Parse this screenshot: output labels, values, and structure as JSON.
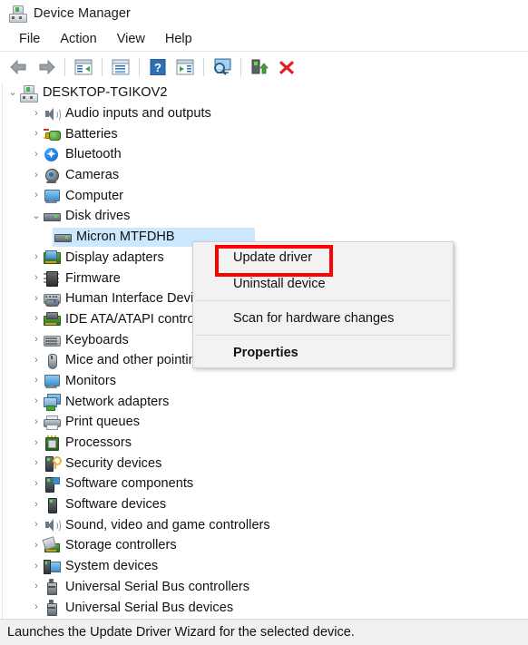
{
  "window": {
    "title": "Device Manager",
    "icon": "device-manager-icon"
  },
  "menubar": {
    "items": [
      {
        "label": "File"
      },
      {
        "label": "Action"
      },
      {
        "label": "View"
      },
      {
        "label": "Help"
      }
    ]
  },
  "toolbar": {
    "buttons": [
      {
        "name": "back-button",
        "icon": "back-arrow-icon"
      },
      {
        "name": "forward-button",
        "icon": "forward-arrow-icon"
      },
      {
        "name": "separator-1",
        "icon": "separator"
      },
      {
        "name": "show-hide-console-tree-button",
        "icon": "console-tree-icon"
      },
      {
        "name": "separator-2",
        "icon": "separator"
      },
      {
        "name": "properties-button",
        "icon": "properties-window-icon"
      },
      {
        "name": "separator-3",
        "icon": "separator"
      },
      {
        "name": "help-button",
        "icon": "question-mark-icon"
      },
      {
        "name": "update-driver-button",
        "icon": "update-driver-icon"
      },
      {
        "name": "separator-4",
        "icon": "separator"
      },
      {
        "name": "scan-hardware-changes-button",
        "icon": "scan-monitor-icon"
      },
      {
        "name": "separator-5",
        "icon": "separator"
      },
      {
        "name": "enable-device-button",
        "icon": "enable-device-icon"
      },
      {
        "name": "uninstall-device-button",
        "icon": "red-x-icon"
      }
    ]
  },
  "tree": {
    "root": {
      "label": "DESKTOP-TGIKOV2",
      "expanded": true,
      "icon": "computer-icon"
    },
    "nodes": [
      {
        "label": "Audio inputs and outputs",
        "icon": "speaker-icon",
        "expanded": false,
        "level": 1
      },
      {
        "label": "Batteries",
        "icon": "battery-icon",
        "expanded": false,
        "level": 1
      },
      {
        "label": "Bluetooth",
        "icon": "bluetooth-icon",
        "expanded": false,
        "level": 1
      },
      {
        "label": "Cameras",
        "icon": "camera-icon",
        "expanded": false,
        "level": 1
      },
      {
        "label": "Computer",
        "icon": "monitor-icon",
        "expanded": false,
        "level": 1
      },
      {
        "label": "Disk drives",
        "icon": "disk-drive-icon",
        "expanded": true,
        "level": 1
      },
      {
        "label": "Micron MTFDHB",
        "icon": "disk-drive-icon",
        "expanded": null,
        "level": 2,
        "selected": true
      },
      {
        "label": "Display adapters",
        "icon": "display-adapter-icon",
        "expanded": false,
        "level": 1
      },
      {
        "label": "Firmware",
        "icon": "firmware-chip-icon",
        "expanded": false,
        "level": 1
      },
      {
        "label": "Human Interface Devices",
        "icon": "human-interface-device-icon",
        "expanded": false,
        "level": 1
      },
      {
        "label": "IDE ATA/ATAPI controllers",
        "icon": "ide-controller-icon",
        "expanded": false,
        "level": 1
      },
      {
        "label": "Keyboards",
        "icon": "keyboard-icon",
        "expanded": false,
        "level": 1
      },
      {
        "label": "Mice and other pointing devices",
        "icon": "mouse-icon",
        "expanded": false,
        "level": 1
      },
      {
        "label": "Monitors",
        "icon": "monitor-icon",
        "expanded": false,
        "level": 1
      },
      {
        "label": "Network adapters",
        "icon": "network-adapter-icon",
        "expanded": false,
        "level": 1
      },
      {
        "label": "Print queues",
        "icon": "printer-icon",
        "expanded": false,
        "level": 1
      },
      {
        "label": "Processors",
        "icon": "processor-icon",
        "expanded": false,
        "level": 1
      },
      {
        "label": "Security devices",
        "icon": "security-device-icon",
        "expanded": false,
        "level": 1
      },
      {
        "label": "Software components",
        "icon": "software-component-icon",
        "expanded": false,
        "level": 1
      },
      {
        "label": "Software devices",
        "icon": "software-device-icon",
        "expanded": false,
        "level": 1
      },
      {
        "label": "Sound, video and game controllers",
        "icon": "speaker-icon",
        "expanded": false,
        "level": 1
      },
      {
        "label": "Storage controllers",
        "icon": "storage-controller-icon",
        "expanded": false,
        "level": 1
      },
      {
        "label": "System devices",
        "icon": "system-device-icon",
        "expanded": false,
        "level": 1
      },
      {
        "label": "Universal Serial Bus controllers",
        "icon": "usb-icon",
        "expanded": false,
        "level": 1
      },
      {
        "label": "Universal Serial Bus devices",
        "icon": "usb-icon",
        "expanded": false,
        "level": 1
      }
    ],
    "expander_collapsed": "›",
    "expander_expanded": "⌄",
    "selection_color": "#cce8ff"
  },
  "context_menu": {
    "items": [
      {
        "label": "Update driver",
        "bold": false,
        "highlighted": true
      },
      {
        "label": "Uninstall device",
        "bold": false,
        "highlighted": false
      },
      {
        "label": "separator",
        "type": "separator"
      },
      {
        "label": "Scan for hardware changes",
        "bold": false,
        "highlighted": false
      },
      {
        "label": "separator",
        "type": "separator"
      },
      {
        "label": "Properties",
        "bold": true,
        "highlighted": false
      }
    ],
    "highlight_color": "#ff0000"
  },
  "statusbar": {
    "text": "Launches the Update Driver Wizard for the selected device."
  }
}
